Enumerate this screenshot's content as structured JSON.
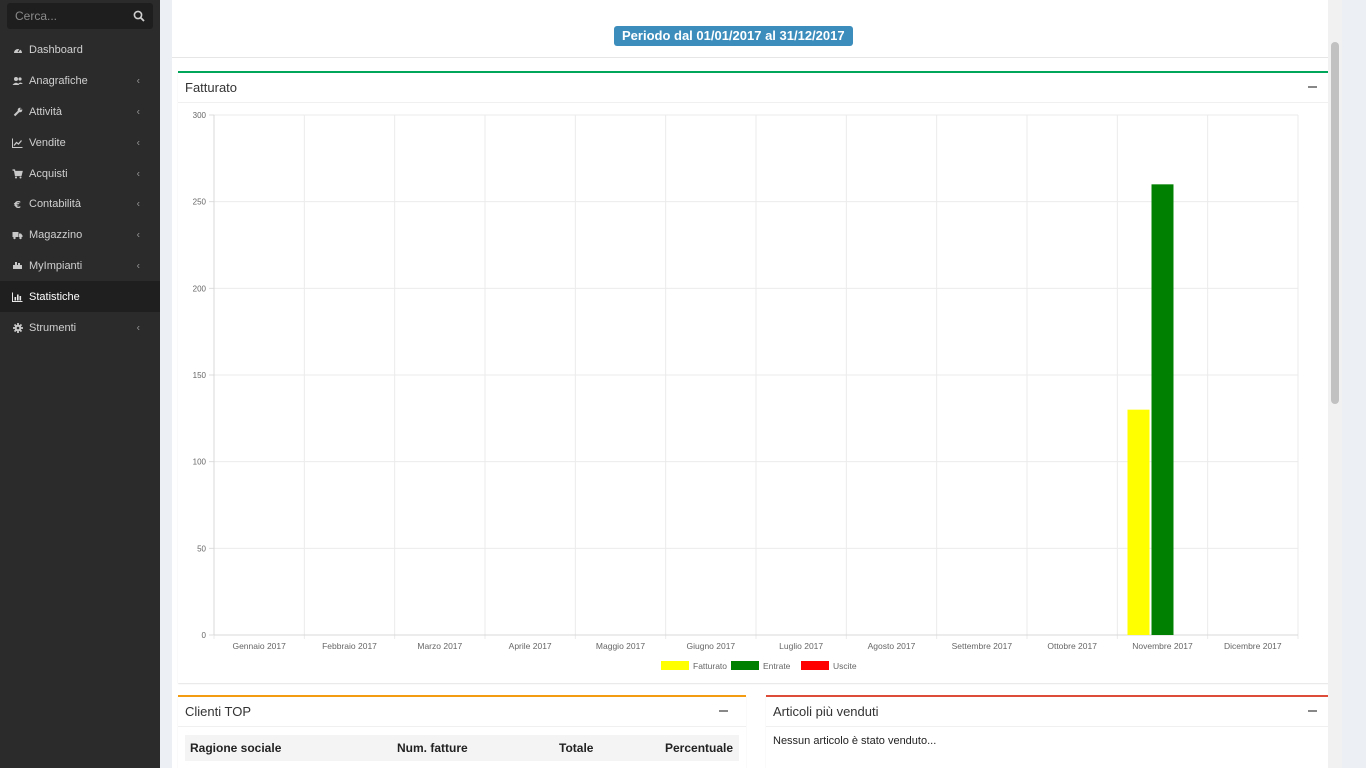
{
  "sidebar": {
    "search_placeholder": "Cerca...",
    "items": [
      {
        "label": "Dashboard",
        "icon": "dashboard-icon",
        "chevron": false,
        "active": false
      },
      {
        "label": "Anagrafiche",
        "icon": "users-icon",
        "chevron": true,
        "active": false
      },
      {
        "label": "Attività",
        "icon": "wrench-icon",
        "chevron": true,
        "active": false
      },
      {
        "label": "Vendite",
        "icon": "line-chart-icon",
        "chevron": true,
        "active": false
      },
      {
        "label": "Acquisti",
        "icon": "cart-icon",
        "chevron": true,
        "active": false
      },
      {
        "label": "Contabilità",
        "icon": "euro-icon",
        "chevron": true,
        "active": false
      },
      {
        "label": "Magazzino",
        "icon": "truck-icon",
        "chevron": true,
        "active": false
      },
      {
        "label": "MyImpianti",
        "icon": "plug-icon",
        "chevron": true,
        "active": false
      },
      {
        "label": "Statistiche",
        "icon": "bar-chart-icon",
        "chevron": false,
        "active": true
      },
      {
        "label": "Strumenti",
        "icon": "cog-icon",
        "chevron": true,
        "active": false
      }
    ]
  },
  "header": {
    "period": "Periodo dal 01/01/2017 al 31/12/2017"
  },
  "fatturato_box": {
    "title": "Fatturato"
  },
  "chart_data": {
    "type": "bar",
    "categories": [
      "Gennaio 2017",
      "Febbraio 2017",
      "Marzo 2017",
      "Aprile 2017",
      "Maggio 2017",
      "Giugno 2017",
      "Luglio 2017",
      "Agosto 2017",
      "Settembre 2017",
      "Ottobre 2017",
      "Novembre 2017",
      "Dicembre 2017"
    ],
    "series": [
      {
        "name": "Fatturato",
        "color": "#ffff00",
        "values": [
          0,
          0,
          0,
          0,
          0,
          0,
          0,
          0,
          0,
          0,
          130,
          0
        ]
      },
      {
        "name": "Entrate",
        "color": "#008000",
        "values": [
          0,
          0,
          0,
          0,
          0,
          0,
          0,
          0,
          0,
          0,
          260,
          0
        ]
      },
      {
        "name": "Uscite",
        "color": "#ff0000",
        "values": [
          0,
          0,
          0,
          0,
          0,
          0,
          0,
          0,
          0,
          0,
          0,
          0
        ]
      }
    ],
    "yticks": [
      0,
      50,
      100,
      150,
      200,
      250,
      300
    ],
    "ylim": [
      0,
      300
    ],
    "grid": true,
    "legend_position": "bottom"
  },
  "clienti_box": {
    "title": "Clienti TOP",
    "columns": [
      "Ragione sociale",
      "Num. fatture",
      "Totale",
      "Percentuale"
    ]
  },
  "articoli_box": {
    "title": "Articoli più venduti",
    "empty_message": "Nessun articolo è stato venduto..."
  }
}
